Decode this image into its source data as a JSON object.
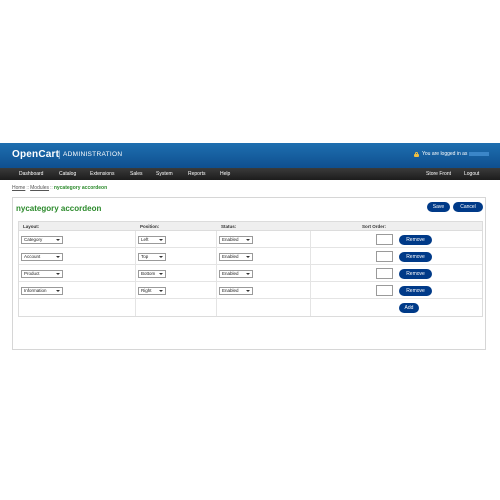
{
  "header": {
    "logo": "OpenCart",
    "separator": "|",
    "admin_label": "ADMINISTRATION",
    "logged_in_text": "You are logged in as"
  },
  "menu": {
    "items": [
      "Dashboard",
      "Catalog",
      "Extensions",
      "Sales",
      "System",
      "Reports",
      "Help"
    ],
    "right_items": [
      "Store Front",
      "Logout"
    ]
  },
  "breadcrumb": {
    "items": [
      "Home",
      "Modules"
    ],
    "separator": "::",
    "current": "nycategory accordeon"
  },
  "box": {
    "heading": "nycategory accordeon",
    "save_label": "Save",
    "cancel_label": "Cancel"
  },
  "table": {
    "headers": [
      "Layout:",
      "Position:",
      "Status:",
      "Sort Order:"
    ],
    "rows": [
      {
        "layout": "Category",
        "position": "Left",
        "status": "Enabled",
        "remove_label": "Remove"
      },
      {
        "layout": "Account",
        "position": "Top",
        "status": "Enabled",
        "remove_label": "Remove"
      },
      {
        "layout": "Product",
        "position": "Bottom",
        "status": "Enabled",
        "remove_label": "Remove"
      },
      {
        "layout": "Information",
        "position": "Right",
        "status": "Enabled",
        "remove_label": "Remove"
      }
    ],
    "add_label": "Add"
  },
  "colors": {
    "header_blue": "#1565a8",
    "menu_dark": "#262626",
    "button_navy": "#003a88",
    "heading_green": "#2b8a2b"
  }
}
